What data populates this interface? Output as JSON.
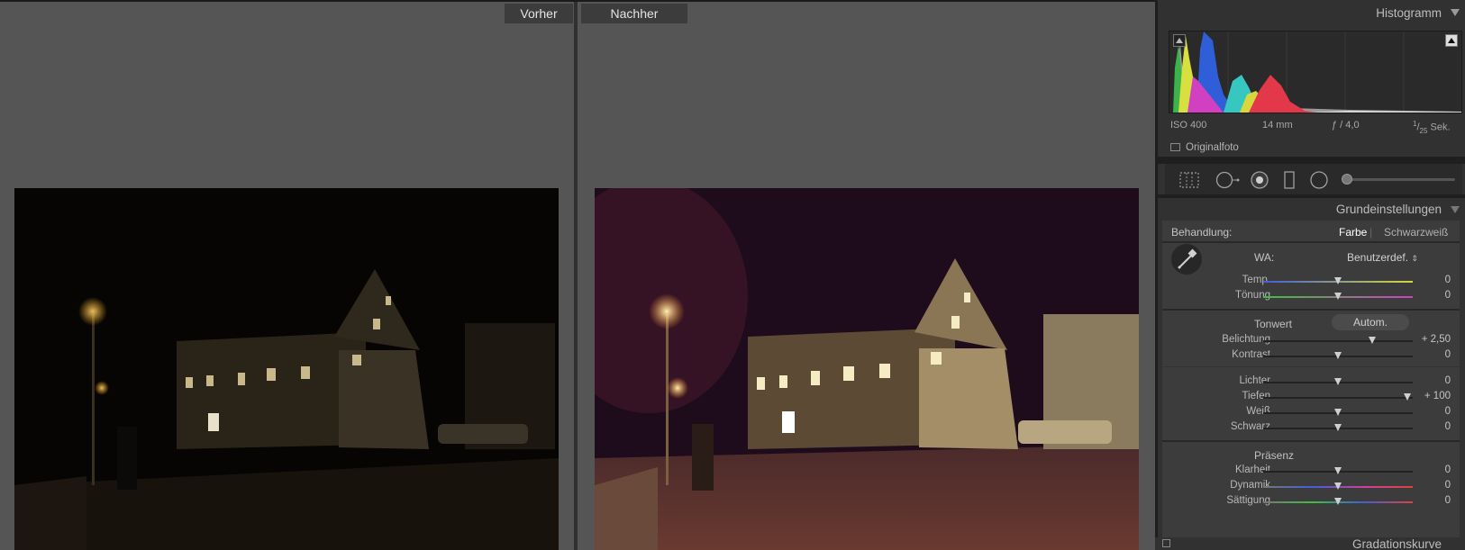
{
  "compare": {
    "before_label": "Vorher",
    "after_label": "Nachher"
  },
  "panel": {
    "histogram_title": "Histogramm",
    "meta": {
      "iso": "ISO 400",
      "focal": "14 mm",
      "aperture": "ƒ / 4,0",
      "shutter_num": "1",
      "shutter_den": "25",
      "shutter_unit": "Sek."
    },
    "original_photo_label": "Originalfoto",
    "basic_title": "Grundeinstellungen",
    "treatment": {
      "label": "Behandlung:",
      "color": "Farbe",
      "bw": "Schwarzweiß"
    },
    "wb": {
      "label": "WA:",
      "value": "Benutzerdef."
    },
    "tone_title": "Tonwert",
    "auto_label": "Autom.",
    "presence_title": "Präsenz",
    "next_panel_title": "Gradationskurve",
    "sliders": {
      "temp": {
        "label": "Temp.",
        "value": "0",
        "pos": 0.5
      },
      "tint": {
        "label": "Tönung",
        "value": "0",
        "pos": 0.5
      },
      "exposure": {
        "label": "Belichtung",
        "value": "+ 2,50",
        "pos": 0.75
      },
      "contrast": {
        "label": "Kontrast",
        "value": "0",
        "pos": 0.5
      },
      "highlights": {
        "label": "Lichter",
        "value": "0",
        "pos": 0.5
      },
      "shadows": {
        "label": "Tiefen",
        "value": "+ 100",
        "pos": 1.0
      },
      "whites": {
        "label": "Weiß",
        "value": "0",
        "pos": 0.5
      },
      "blacks": {
        "label": "Schwarz",
        "value": "0",
        "pos": 0.5
      },
      "clarity": {
        "label": "Klarheit",
        "value": "0",
        "pos": 0.5
      },
      "vibrance": {
        "label": "Dynamik",
        "value": "0",
        "pos": 0.5
      },
      "saturation": {
        "label": "Sättigung",
        "value": "0",
        "pos": 0.5
      }
    }
  },
  "colors": {
    "panel_bg": "#313131",
    "active_option": "#ffffff",
    "inactive_option": "#b0b0b0"
  }
}
